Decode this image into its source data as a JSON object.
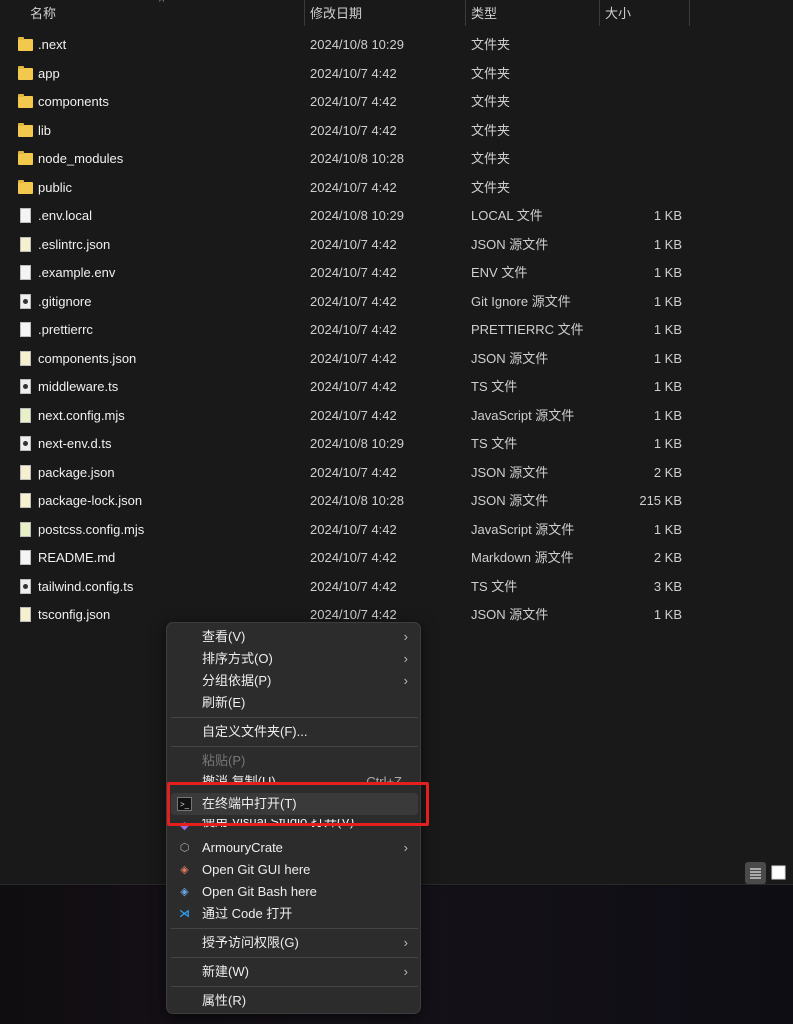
{
  "columns": {
    "name": "名称",
    "modified": "修改日期",
    "type": "类型",
    "size": "大小"
  },
  "files": [
    {
      "name": ".next",
      "date": "2024/10/8 10:29",
      "type": "文件夹",
      "size": "",
      "icon": "folder"
    },
    {
      "name": "app",
      "date": "2024/10/7 4:42",
      "type": "文件夹",
      "size": "",
      "icon": "folder"
    },
    {
      "name": "components",
      "date": "2024/10/7 4:42",
      "type": "文件夹",
      "size": "",
      "icon": "folder"
    },
    {
      "name": "lib",
      "date": "2024/10/7 4:42",
      "type": "文件夹",
      "size": "",
      "icon": "folder"
    },
    {
      "name": "node_modules",
      "date": "2024/10/8 10:28",
      "type": "文件夹",
      "size": "",
      "icon": "folder"
    },
    {
      "name": "public",
      "date": "2024/10/7 4:42",
      "type": "文件夹",
      "size": "",
      "icon": "folder"
    },
    {
      "name": ".env.local",
      "date": "2024/10/8 10:29",
      "type": "LOCAL 文件",
      "size": "1 KB",
      "icon": "file"
    },
    {
      "name": ".eslintrc.json",
      "date": "2024/10/7 4:42",
      "type": "JSON 源文件",
      "size": "1 KB",
      "icon": "json"
    },
    {
      "name": ".example.env",
      "date": "2024/10/7 4:42",
      "type": "ENV 文件",
      "size": "1 KB",
      "icon": "file"
    },
    {
      "name": ".gitignore",
      "date": "2024/10/7 4:42",
      "type": "Git Ignore 源文件",
      "size": "1 KB",
      "icon": "ts"
    },
    {
      "name": ".prettierrc",
      "date": "2024/10/7 4:42",
      "type": "PRETTIERRC 文件",
      "size": "1 KB",
      "icon": "file"
    },
    {
      "name": "components.json",
      "date": "2024/10/7 4:42",
      "type": "JSON 源文件",
      "size": "1 KB",
      "icon": "json"
    },
    {
      "name": "middleware.ts",
      "date": "2024/10/7 4:42",
      "type": "TS 文件",
      "size": "1 KB",
      "icon": "ts"
    },
    {
      "name": "next.config.mjs",
      "date": "2024/10/7 4:42",
      "type": "JavaScript 源文件",
      "size": "1 KB",
      "icon": "js"
    },
    {
      "name": "next-env.d.ts",
      "date": "2024/10/8 10:29",
      "type": "TS 文件",
      "size": "1 KB",
      "icon": "ts"
    },
    {
      "name": "package.json",
      "date": "2024/10/7 4:42",
      "type": "JSON 源文件",
      "size": "2 KB",
      "icon": "json"
    },
    {
      "name": "package-lock.json",
      "date": "2024/10/8 10:28",
      "type": "JSON 源文件",
      "size": "215 KB",
      "icon": "json"
    },
    {
      "name": "postcss.config.mjs",
      "date": "2024/10/7 4:42",
      "type": "JavaScript 源文件",
      "size": "1 KB",
      "icon": "js"
    },
    {
      "name": "README.md",
      "date": "2024/10/7 4:42",
      "type": "Markdown 源文件",
      "size": "2 KB",
      "icon": "file"
    },
    {
      "name": "tailwind.config.ts",
      "date": "2024/10/7 4:42",
      "type": "TS 文件",
      "size": "3 KB",
      "icon": "ts"
    },
    {
      "name": "tsconfig.json",
      "date": "2024/10/7 4:42",
      "type": "JSON 源文件",
      "size": "1 KB",
      "icon": "json"
    }
  ],
  "menu": {
    "view": "查看(V)",
    "sort": "排序方式(O)",
    "group": "分组依据(P)",
    "refresh": "刷新(E)",
    "customize": "自定义文件夹(F)...",
    "paste": "粘贴(P)",
    "undo": "撤消 复制(U)",
    "undo_shortcut": "Ctrl+Z",
    "terminal": "在终端中打开(T)",
    "visual_studio": "使用 Visual Studio 打开(V)",
    "armoury": "ArmouryCrate",
    "git_gui": "Open Git GUI here",
    "git_bash": "Open Git Bash here",
    "vscode": "通过 Code 打开",
    "access": "授予访问权限(G)",
    "new": "新建(W)",
    "properties": "属性(R)"
  },
  "colors": {
    "highlight_box": "#e51e1e",
    "folder": "#f2c94c"
  }
}
